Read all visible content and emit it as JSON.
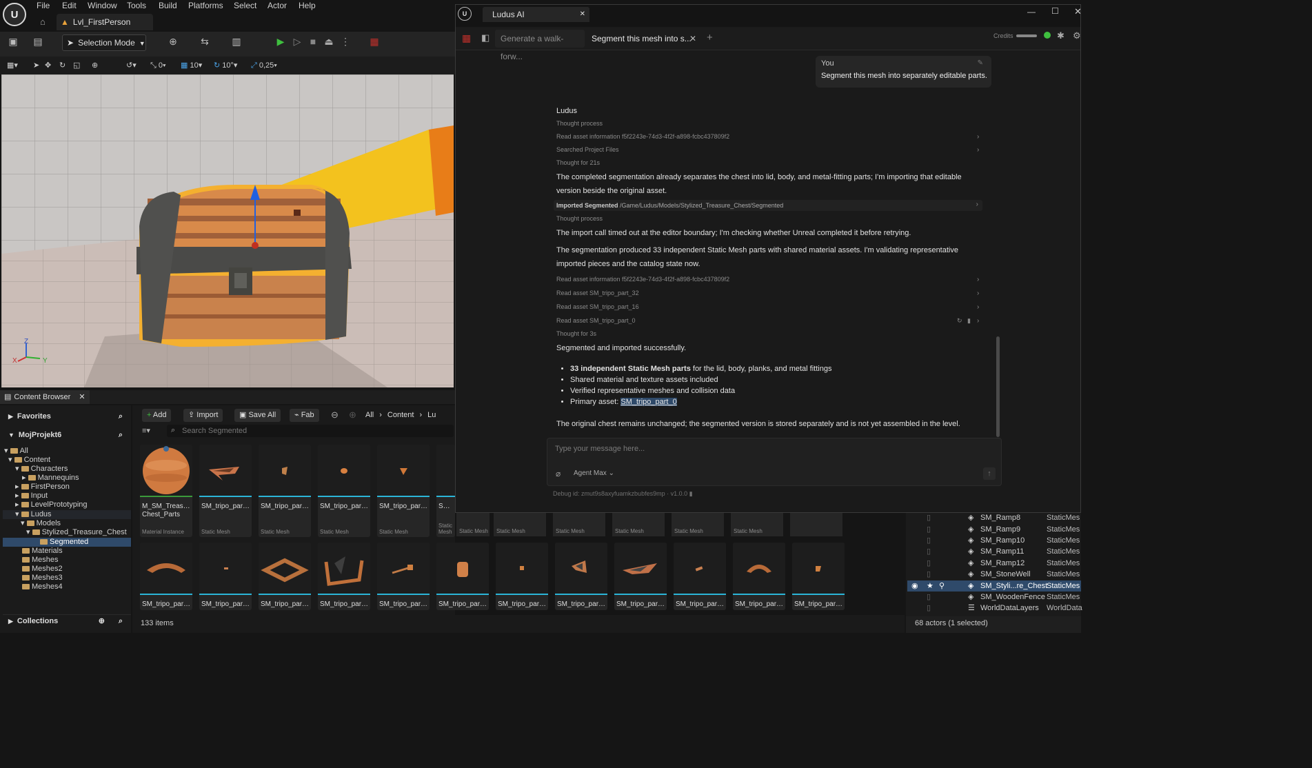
{
  "editor": {
    "menu": [
      "File",
      "Edit",
      "Window",
      "Tools",
      "Build",
      "Platforms",
      "Select",
      "Actor",
      "Help"
    ],
    "level_tab": "Lvl_FirstPerson",
    "selection_mode": "Selection Mode",
    "viewport_toolbar": {
      "rotation_snap": "0",
      "grid_snap": "10",
      "angle_snap": "10°",
      "scale_snap": "0,25"
    },
    "axes": {
      "z": "Z",
      "x": "X",
      "y": "Y"
    }
  },
  "content_browser": {
    "tab_label": "Content Browser",
    "favorites_label": "Favorites",
    "project_label": "MojProjekt6",
    "collections_label": "Collections",
    "tree": [
      "All",
      "Content",
      "Characters",
      "Mannequins",
      "FirstPerson",
      "Input",
      "LevelPrototyping",
      "Ludus",
      "Models",
      "Stylized_Treasure_Chest",
      "Segmented",
      "Materials",
      "Meshes",
      "Meshes2",
      "Meshes3",
      "Meshes4"
    ],
    "buttons": {
      "add": "Add",
      "import": "Import",
      "save_all": "Save All",
      "fab": "Fab"
    },
    "breadcrumb": [
      "All",
      "Content",
      "Lu"
    ],
    "search_placeholder": "Search Segmented",
    "item_count": "133 items",
    "row1": [
      {
        "name": "M_SM_Treasure Chest_Parts",
        "type": "Material Instance"
      },
      {
        "name": "SM_tripo_part_0",
        "type": "Static Mesh"
      },
      {
        "name": "SM_tripo_part_1",
        "type": "Static Mesh"
      },
      {
        "name": "SM_tripo_part_2",
        "type": "Static Mesh"
      },
      {
        "name": "SM_tripo_part_3",
        "type": "Static Mesh"
      },
      {
        "name": "SM_tr",
        "type": "Static Mesh"
      }
    ],
    "row1_hidden_types": [
      "Static Mesh",
      "Static Mesh",
      "Static Mesh",
      "Static Mesh",
      "Static Mesh",
      "Static Mesh"
    ],
    "row2_name": "SM_tripo_part_..."
  },
  "outliner": {
    "rows": [
      {
        "name": "SM_Ramp8",
        "type": "StaticMes"
      },
      {
        "name": "SM_Ramp9",
        "type": "StaticMes"
      },
      {
        "name": "SM_Ramp10",
        "type": "StaticMes"
      },
      {
        "name": "SM_Ramp11",
        "type": "StaticMes"
      },
      {
        "name": "SM_Ramp12",
        "type": "StaticMes"
      },
      {
        "name": "SM_StoneWell",
        "type": "StaticMes"
      },
      {
        "name": "SM_Styli...re_Chest",
        "type": "StaticMes"
      },
      {
        "name": "SM_WoodenFence",
        "type": "StaticMes"
      },
      {
        "name": "WorldDataLayers",
        "type": "WorldData"
      }
    ],
    "status": "68 actors (1 selected)"
  },
  "ludus": {
    "window_title": "Ludus AI",
    "tabs": [
      {
        "label": "Generate a walk-forw..."
      },
      {
        "label": "Segment this mesh into s..."
      }
    ],
    "credits_label": "Credits",
    "user_name": "You",
    "user_message": "Segment this mesh into separately editable parts.",
    "assistant_name": "Ludus",
    "steps": {
      "thought1": "Thought process",
      "read_info1": "Read asset information  f5f2243e-74d3-4f2f-a898-fcbc437809f2",
      "searched": "Searched Project Files",
      "thought21": "Thought for 21s",
      "msg1": "The completed segmentation already separates the chest into lid, body, and metal-fitting parts; I'm importing that editable version beside the original asset.",
      "imported_label": "Imported Segmented",
      "imported_path": "/Game/Ludus/Models/Stylized_Treasure_Chest/Segmented",
      "thought2": "Thought process",
      "msg2": "The import call timed out at the editor boundary; I'm checking whether Unreal completed it before retrying.",
      "msg3": "The segmentation produced 33 independent Static Mesh parts with shared material assets. I'm validating representative imported pieces and the catalog state now.",
      "read_info2": "Read asset information  f5f2243e-74d3-4f2f-a898-fcbc437809f2",
      "read32": "Read asset SM_tripo_part_32",
      "read16": "Read asset SM_tripo_part_16",
      "read0": "Read asset SM_tripo_part_0",
      "thought3": "Thought for 3s",
      "success": "Segmented and imported successfully.",
      "bullet1_bold": "33 independent Static Mesh parts",
      "bullet1_rest": " for the lid, body, planks, and metal fittings",
      "bullet2": "Shared material and texture assets included",
      "bullet3": "Verified representative meshes and collision data",
      "bullet4_prefix": "Primary asset: ",
      "bullet4_link": "SM_tripo_part_0",
      "final": "The original chest remains unchanged; the segmented version is stored separately and is not yet assembled in the level."
    },
    "input_placeholder": "Type your message here...",
    "agent_mode": "Agent Max",
    "debug_id": "Debug id: zmut9s8axyfuamkzbubfes9mp · v1.0.0"
  },
  "colors": {
    "accent_blue": "#2bb5d8",
    "play_green": "#3fbf3f",
    "selection": "#2f4a6a"
  }
}
